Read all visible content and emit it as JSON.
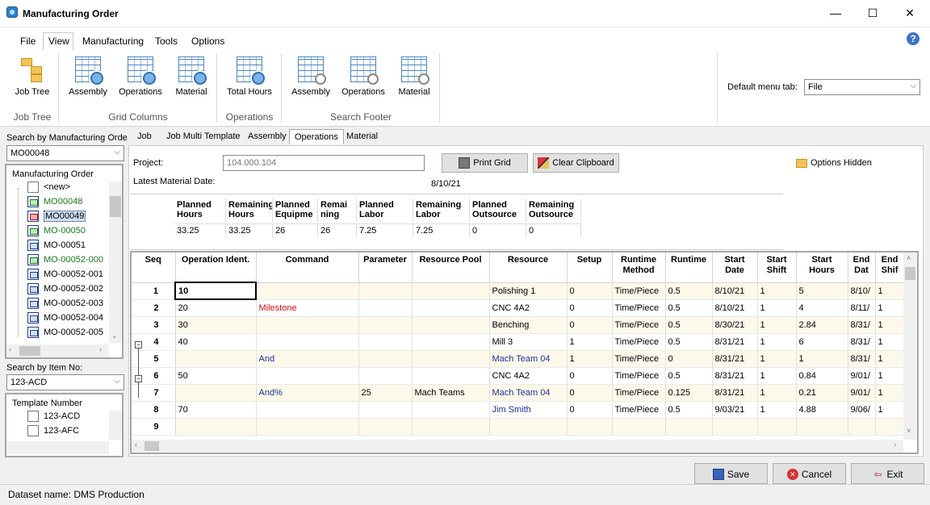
{
  "window": {
    "title": "Manufacturing Order",
    "minimize": "—",
    "maximize": "☐",
    "close": "✕"
  },
  "menu": [
    "File",
    "View",
    "Manufacturing",
    "Tools",
    "Options"
  ],
  "ribbon": {
    "buttons": {
      "job_tree": "Job Tree",
      "gc_assembly": "Assembly",
      "gc_operations": "Operations",
      "gc_material": "Material",
      "total_hours": "Total Hours",
      "sf_assembly": "Assembly",
      "sf_operations": "Operations",
      "sf_material": "Material"
    },
    "groups": {
      "job_tree": "Job Tree",
      "grid_columns": "Grid Columns",
      "operations": "Operations",
      "search_footer": "Search Footer"
    },
    "default_menu_tab_label": "Default menu tab:",
    "default_menu_tab_value": "File"
  },
  "left": {
    "search_mo_label": "Search by Manufacturing Orde",
    "search_mo_value": "MO00048",
    "mo_header": "Manufacturing Order",
    "mo_items": [
      {
        "label": "<new>",
        "style": "new"
      },
      {
        "label": "MO00048",
        "style": "green"
      },
      {
        "label": "MO00049",
        "style": "selected"
      },
      {
        "label": "MO-00050",
        "style": "green"
      },
      {
        "label": "MO-00051",
        "style": "normal"
      },
      {
        "label": "MO-00052-000",
        "style": "green"
      },
      {
        "label": "MO-00052-001",
        "style": "normal"
      },
      {
        "label": "MO-00052-002",
        "style": "normal"
      },
      {
        "label": "MO-00052-003",
        "style": "normal"
      },
      {
        "label": "MO-00052-004",
        "style": "normal"
      },
      {
        "label": "MO-00052-005",
        "style": "normal"
      }
    ],
    "search_item_label": "Search by Item No:",
    "search_item_value": "123-ACD",
    "template_header": "Template Number",
    "template_items": [
      "123-ACD",
      "123-AFC"
    ]
  },
  "tabs": [
    "Job",
    "Job Multi Template",
    "Assembly",
    "Operations",
    "Material"
  ],
  "content": {
    "project_label": "Project:",
    "project_value": "104.000.104",
    "latest_material_label": "Latest Material Date:",
    "latest_material_value": "8/10/21",
    "print_grid": "Print Grid",
    "clear_clipboard": "Clear Clipboard",
    "options_hidden": "Options Hidden"
  },
  "summary": {
    "headers": [
      "Planned Hours",
      "Remaining Hours",
      "Planned Equipme",
      "Remai ning",
      "Planned Labor",
      "Remaining Labor",
      "Planned Outsource",
      "Remaining Outsource"
    ],
    "values": [
      "33.25",
      "33.25",
      "26",
      "26",
      "7.25",
      "7.25",
      "0",
      "0"
    ]
  },
  "grid": {
    "columns": [
      "Seq",
      "Operation Ident.",
      "Command",
      "Parameter",
      "Resource Pool",
      "Resource",
      "Setup",
      "Runtime Method",
      "Runtime",
      "Start Date",
      "Start Shift",
      "Start Hours",
      "End Dat",
      "End Shif"
    ],
    "rows": [
      {
        "seq": "1",
        "op": "10",
        "cmd": "",
        "cmd_color": "",
        "param": "",
        "pool": "",
        "res": "Polishing 1",
        "res_color": "",
        "setup": "0",
        "method": "Time/Piece",
        "runtime": "0.5",
        "sdate": "8/10/21",
        "sshift": "1",
        "shours": "5",
        "edate": "8/10/",
        "eshift": "1"
      },
      {
        "seq": "2",
        "op": "20",
        "cmd": "Milestone",
        "cmd_color": "red",
        "param": "",
        "pool": "",
        "res": "CNC 4A2",
        "res_color": "",
        "setup": "0",
        "method": "Time/Piece",
        "runtime": "0.5",
        "sdate": "8/10/21",
        "sshift": "1",
        "shours": "4",
        "edate": "8/11/",
        "eshift": "1"
      },
      {
        "seq": "3",
        "op": "30",
        "cmd": "",
        "cmd_color": "",
        "param": "",
        "pool": "",
        "res": "Benching",
        "res_color": "",
        "setup": "0",
        "method": "Time/Piece",
        "runtime": "0.5",
        "sdate": "8/30/21",
        "sshift": "1",
        "shours": "2.84",
        "edate": "8/31/",
        "eshift": "1"
      },
      {
        "seq": "4",
        "op": "40",
        "cmd": "",
        "cmd_color": "",
        "param": "",
        "pool": "",
        "res": "Mill 3",
        "res_color": "",
        "setup": "1",
        "method": "Time/Piece",
        "runtime": "0.5",
        "sdate": "8/31/21",
        "sshift": "1",
        "shours": "6",
        "edate": "8/31/",
        "eshift": "1"
      },
      {
        "seq": "5",
        "op": "",
        "cmd": "And",
        "cmd_color": "blue",
        "param": "",
        "pool": "",
        "res": "Mach Team 04",
        "res_color": "blue",
        "setup": "1",
        "method": "Time/Piece",
        "runtime": "0",
        "sdate": "8/31/21",
        "sshift": "1",
        "shours": "1",
        "edate": "8/31/",
        "eshift": "1"
      },
      {
        "seq": "6",
        "op": "50",
        "cmd": "",
        "cmd_color": "",
        "param": "",
        "pool": "",
        "res": "CNC 4A2",
        "res_color": "",
        "setup": "0",
        "method": "Time/Piece",
        "runtime": "0.5",
        "sdate": "8/31/21",
        "sshift": "1",
        "shours": "0.84",
        "edate": "9/01/",
        "eshift": "1"
      },
      {
        "seq": "7",
        "op": "",
        "cmd": "And%",
        "cmd_color": "blue",
        "param": "25",
        "pool": "Mach Teams",
        "res": "Mach Team 04",
        "res_color": "blue",
        "setup": "0",
        "method": "Time/Piece",
        "runtime": "0.125",
        "sdate": "8/31/21",
        "sshift": "1",
        "shours": "0.21",
        "edate": "9/01/",
        "eshift": "1"
      },
      {
        "seq": "8",
        "op": "70",
        "cmd": "",
        "cmd_color": "",
        "param": "",
        "pool": "",
        "res": "Jim Smith",
        "res_color": "blue",
        "setup": "0",
        "method": "Time/Piece",
        "runtime": "0.5",
        "sdate": "9/03/21",
        "sshift": "1",
        "shours": "4.88",
        "edate": "9/06/",
        "eshift": "1"
      },
      {
        "seq": "9",
        "op": "",
        "cmd": "",
        "cmd_color": "",
        "param": "",
        "pool": "",
        "res": "",
        "res_color": "",
        "setup": "",
        "method": "",
        "runtime": "",
        "sdate": "",
        "sshift": "",
        "shours": "",
        "edate": "",
        "eshift": ""
      }
    ]
  },
  "footer": {
    "save": "Save",
    "cancel": "Cancel",
    "exit": "Exit"
  },
  "status": {
    "dataset": "Dataset name:  DMS Production"
  }
}
